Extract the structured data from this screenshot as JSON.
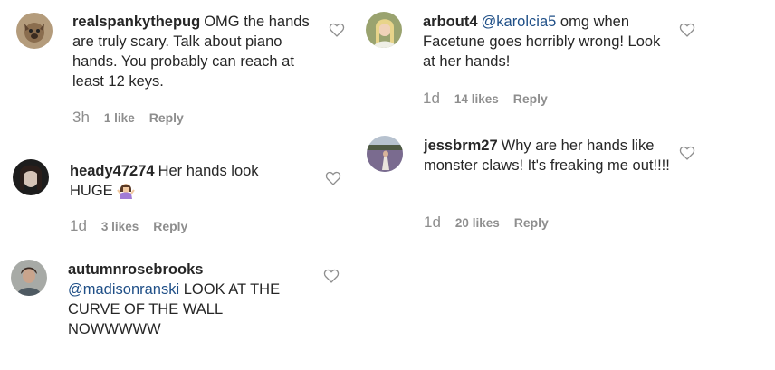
{
  "comments": [
    {
      "username": "realspankythepug",
      "mention": "",
      "text": "OMG the hands are truly scary. Talk about piano hands. You probably can reach at least 12 keys.",
      "time": "3h",
      "likes": "1 like",
      "reply": "Reply"
    },
    {
      "username": "heady47274",
      "mention": "",
      "text": "Her hands look HUGE",
      "emoji": "woman-shrugging-emoji",
      "time": "1d",
      "likes": "3 likes",
      "reply": "Reply"
    },
    {
      "username": "autumnrosebrooks",
      "mention": "@madisonranski",
      "text": "LOOK AT THE CURVE OF THE WALL NOWWWWW",
      "time": "",
      "likes": "",
      "reply": ""
    },
    {
      "username": "arbout4",
      "mention": "@karolcia5",
      "text": "omg when Facetune goes horribly wrong! Look at her hands!",
      "time": "1d",
      "likes": "14 likes",
      "reply": "Reply"
    },
    {
      "username": "jessbrm27",
      "mention": "",
      "text": "Why are her hands like monster claws! It's freaking me out!!!!",
      "time": "1d",
      "likes": "20 likes",
      "reply": "Reply"
    }
  ],
  "colors": {
    "text": "#262626",
    "muted": "#8e8e8e",
    "mention": "#1f4f87"
  },
  "icons": [
    "heart-outline-icon",
    "woman-shrugging-emoji"
  ]
}
